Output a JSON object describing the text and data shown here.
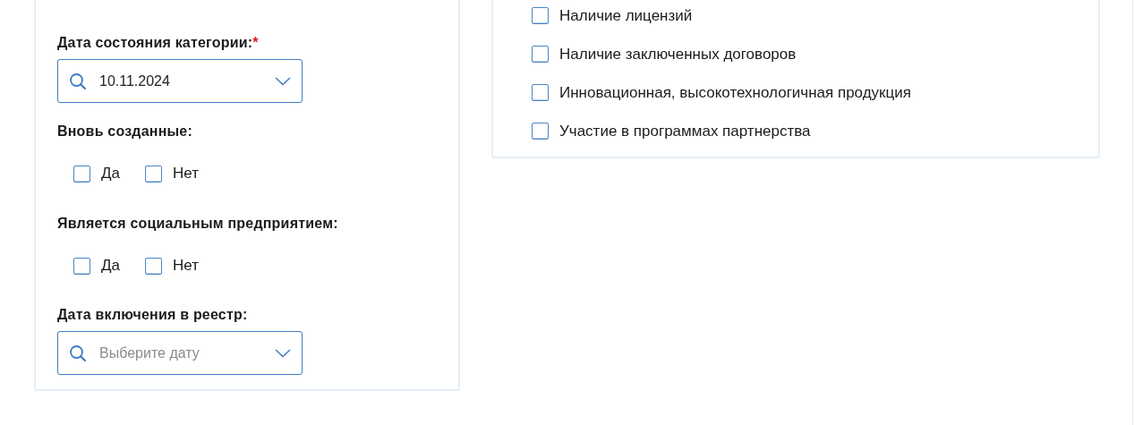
{
  "filters": [
    {
      "kind": "date",
      "label": "Дата состояния категории:",
      "required_mark": "*",
      "value": "10.11.2024"
    },
    {
      "kind": "yesno",
      "label": "Вновь созданные:",
      "options": [
        {
          "label": "Да",
          "checked": false
        },
        {
          "label": "Нет",
          "checked": false
        }
      ]
    },
    {
      "kind": "yesno",
      "label": "Является социальным предприятием:",
      "options": [
        {
          "label": "Да",
          "checked": false
        },
        {
          "label": "Нет",
          "checked": false
        }
      ]
    },
    {
      "kind": "date",
      "label": "Дата включения в реестр:",
      "placeholder": "Выберите дату"
    }
  ],
  "attributes": [
    {
      "label": "Наличие лицензий",
      "checked": false
    },
    {
      "label": "Наличие заключенных договоров",
      "checked": false
    },
    {
      "label": "Инновационная, высокотехнологичная продукция",
      "checked": false
    },
    {
      "label": "Участие в программах партнерства",
      "checked": false
    }
  ]
}
